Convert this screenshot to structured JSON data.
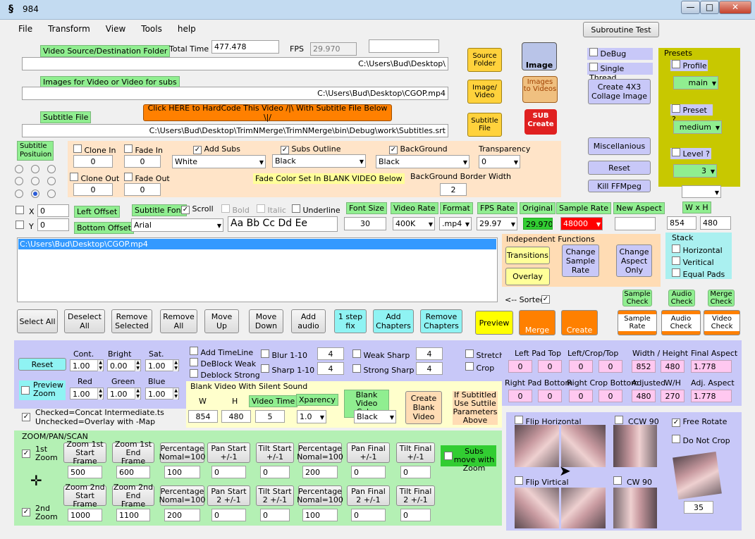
{
  "window": {
    "icon": "§",
    "title": "984",
    "min": "—",
    "max": "□",
    "close": "✕"
  },
  "menu": [
    "File",
    "Transform",
    "View",
    "Tools",
    "help"
  ],
  "subroutine_btn": "Subroutine Test",
  "source": {
    "label": "Video  Source/Destination Folder",
    "total_time_label": "Total Time",
    "total_time": "477.478",
    "fps_label": "FPS",
    "fps": "29.970",
    "path": "C:\\Users\\Bud\\Desktop\\"
  },
  "images": {
    "label": "Images for Video or Video for subs",
    "path": "C:\\Users\\Bud\\Desktop\\CGOP.mp4"
  },
  "subtitle": {
    "label": "Subtitle File",
    "hardcode_btn": "Click HERE to HardCode This Video  /|\\   With Subtitle File Below  \\|/",
    "path": "C:\\Users\\Bud\\Desktop\\TrimNMerge\\TrimNMerge\\bin\\Debug\\work\\Subtitles.srt"
  },
  "icons": {
    "source_folder": "Source Folder",
    "image_video": "Image/ Video",
    "subtitle_file": "Subtitle File",
    "image": "Image",
    "images_to_videos": "Images to Videos",
    "sub_create_top": "SUB",
    "sub_create_bottom": "Create"
  },
  "right": {
    "debug": "DeBug",
    "single_thread": "Single Thread",
    "collage": "Create 4X3 Collage Image",
    "misc": "Miscellanious",
    "reset": "Reset",
    "kill": "Kill FFMpeg"
  },
  "presets": {
    "title": "Presets",
    "profile": "Profile",
    "profile_val": "main",
    "preset": "Preset ?",
    "preset_val": "medium",
    "level": "Level ?",
    "level_val": "3"
  },
  "subpos": {
    "label": "Subtitle Posituion"
  },
  "effects": {
    "clone_in": "Clone In",
    "clone_in_val": "0",
    "fade_in": "Fade In",
    "fade_in_val": "0",
    "add_subs": "Add Subs",
    "subs_color": "White",
    "subs_outline": "Subs Outline",
    "outline_color": "Black",
    "background": "BackGround",
    "bg_color": "Black",
    "transparency": "Transparency",
    "transparency_val": "0",
    "clone_out": "Clone Out",
    "clone_out_val": "0",
    "fade_out": "Fade Out",
    "fade_out_val": "0",
    "fade_note": "Fade Color Set In BLANK VIDEO Below",
    "bg_border": "BackGround Border Width",
    "bg_border_val": "2"
  },
  "offset": {
    "x": "X",
    "x_val": "0",
    "y": "Y",
    "y_val": "0",
    "left": "Left Offset",
    "bottom": "Bottom Offset"
  },
  "font": {
    "label": "Subtitle Font",
    "scroll": "Scroll",
    "bold": "Bold",
    "italic": "Italic",
    "underline": "Underline",
    "font": "Arial",
    "sample": "Aa Bb Cc Dd Ee"
  },
  "params": {
    "font_size": "Font Size",
    "font_size_val": "30",
    "video_rate": "Video Rate",
    "video_rate_val": "400K",
    "format": "Format",
    "format_val": ".mp4",
    "fps_rate": "FPS Rate",
    "fps_rate_val": "29.97",
    "original": "Original",
    "original_val": "29.970",
    "sample_rate": "Sample Rate",
    "sample_rate_val": "48000",
    "new_aspect": "New Aspect",
    "wxh": "W x H",
    "w": "854",
    "h": "480"
  },
  "list": {
    "item": "C:\\Users\\Bud\\Desktop\\CGOP.mp4"
  },
  "indep": {
    "title": "Independent Functions",
    "transitions": "Transitions",
    "overlay": "Overlay",
    "change_sample": "Change Sample Rate",
    "change_aspect": "Change Aspect Only"
  },
  "stack": {
    "title": "Stack",
    "horizontal": "Horizontal",
    "vertical": "Veritical",
    "equal": "Equal Pads"
  },
  "sorted": "<-- Sorted",
  "checks": {
    "sample": "Sample Check",
    "audio": "Audio Check",
    "merge": "Merge Check"
  },
  "buttons": {
    "select_all": "Select All",
    "deselect_all": "Deselect All",
    "remove_selected": "Remove Selected",
    "remove_all": "Remove All",
    "move_up": "Move Up",
    "move_down": "Move Down",
    "add_audio": "Add audio",
    "one_step": "1 step fix",
    "add_chapters": "Add Chapters",
    "remove_chapters": "Remove Chapters",
    "preview": "Preview",
    "merge": "Merge",
    "create": "Create",
    "sample_rate": "Sample Rate",
    "audio_check": "Audio Check",
    "video_check": "Video Check"
  },
  "adjust": {
    "reset": "Reset",
    "cont": "Cont.",
    "cont_val": "1.00",
    "bright": "Bright",
    "bright_val": "0.00",
    "sat": "Sat.",
    "sat_val": "1.00",
    "red": "Red",
    "red_val": "1.00",
    "green": "Green",
    "green_val": "1.00",
    "blue": "Blue",
    "blue_val": "1.00",
    "preview_zoom": "Preview Zoom",
    "add_timeline": "Add TimeLine",
    "deblock_weak": "DeBlock Weak",
    "deblock_strong": "Deblock Strong",
    "blur": "Blur 1-10",
    "blur_val": "4",
    "sharp": "Sharp 1-10",
    "sharp_val": "4",
    "weak_sharp": "Weak Sharp",
    "weak_sharp_val": "4",
    "strong_sharp": "Strong Sharp",
    "strong_sharp_val": "4",
    "stretch": "Stretch",
    "crop": "Crop"
  },
  "pads": {
    "lpt": "Left Pad Top",
    "lct": "Left/Crop/Top",
    "wh": "Width / Height",
    "final_aspect": "Final Aspect",
    "v1": "0",
    "v2": "0",
    "v3": "0",
    "v4": "0",
    "w": "852",
    "h": "480",
    "fa": "1.778",
    "rpb": "Right Pad Bottom",
    "rcb": "Right Crop Bottom",
    "adjusted": "Adjusted",
    "wh2": "W/H",
    "adj_aspect": "Adj. Aspect",
    "r1": "0",
    "r2": "0",
    "r3": "0",
    "r4": "0",
    "aw": "480",
    "ah": "270",
    "aa": "1.778"
  },
  "blank": {
    "title": "Blank Video With Silent Sound",
    "w": "W",
    "h": "H",
    "video_time": "Video Time",
    "xparency": "Xparency",
    "color_label": "Blank Video Color",
    "w_val": "854",
    "h_val": "480",
    "time_val": "5",
    "xp_val": "1.0",
    "color": "Black",
    "create": "Create Blank Video",
    "note": "If Subtitled Use Suttile Parameters Above"
  },
  "concat": "Checked=Concat Intermediate.ts\nUnchecked=Overlay with -Map",
  "zoom": {
    "title": "ZOOM/PAN/SCAN",
    "first": "1st Zoom",
    "second": "2nd Zoom",
    "subs_move": "Subs move with Zoom",
    "h1": [
      "Zoom 1st Start Frame",
      "Zoom 1st End Frame",
      "Percentage Nomal=100",
      "Pan Start +/-1",
      "Tilt Start +/-1",
      "Percentage Nomal=100",
      "Pan Final +/-1",
      "Tilt Final +/-1"
    ],
    "v1": [
      "500",
      "600",
      "100",
      "0",
      "0",
      "200",
      "0",
      "0"
    ],
    "h2": [
      "Zoom 2nd Start Frame",
      "Zoom 2nd End Frame",
      "Percentage Nomal=100",
      "Pan Start 2 +/-1",
      "Tilt Start 2 +/-1",
      "Percentage Nomal=100",
      "Pan Final 2 +/-1",
      "Tilt Final 2 +/-1"
    ],
    "v2": [
      "1000",
      "1100",
      "200",
      "0",
      "0",
      "100",
      "0",
      "0"
    ]
  },
  "rotate": {
    "flip_h": "Flip Horizontal",
    "ccw": "CCW 90",
    "free": "Free Rotate",
    "no_crop": "Do Not Crop",
    "flip_v": "Flip Virtical",
    "cw": "CW 90",
    "angle": "35"
  }
}
